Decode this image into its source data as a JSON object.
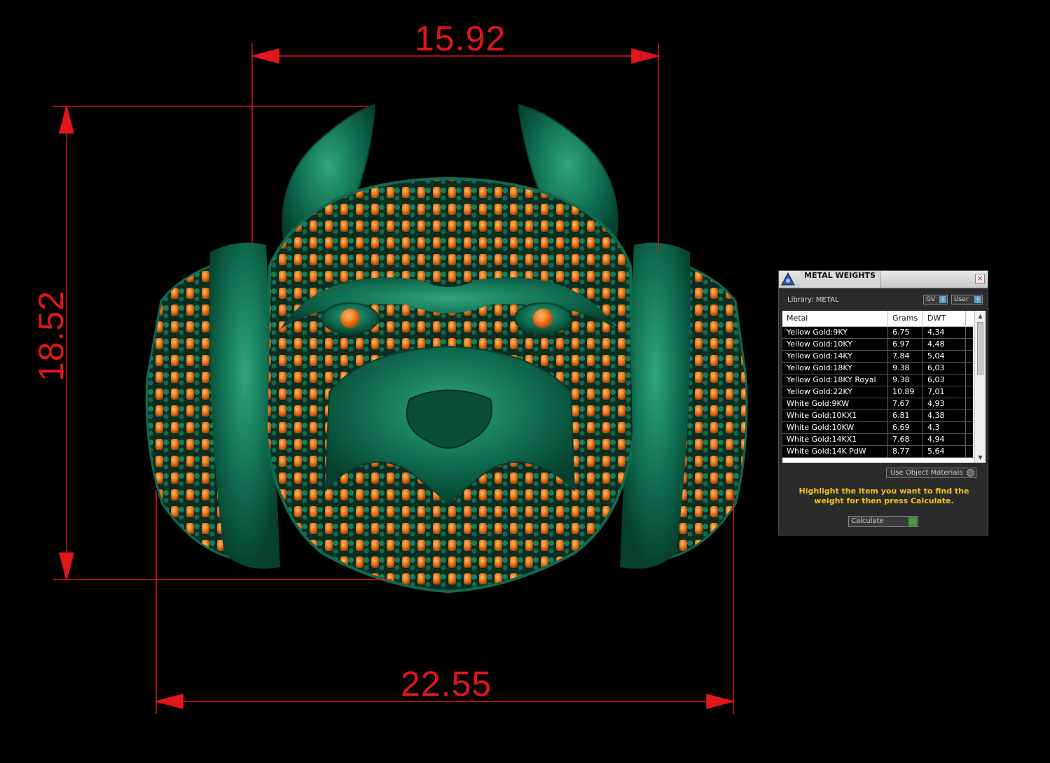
{
  "dimensions": {
    "top_width": "15.92",
    "left_height": "18.52",
    "bottom_width": "22.55"
  },
  "colors": {
    "dimension_lines": "#e0161c",
    "ring_metal": "#0f6b4f",
    "stones": "#f07a1a",
    "background": "#000000"
  },
  "panel": {
    "title": "METAL WEIGHTS",
    "close_glyph": "×",
    "library_label": "Library: METAL",
    "gv_label": "GV",
    "user_label": "User",
    "columns": [
      "Metal",
      "Grams",
      "DWT"
    ],
    "rows": [
      {
        "metal": "Yellow Gold:9KY",
        "grams": "6.75",
        "dwt": "4,34"
      },
      {
        "metal": "Yellow Gold:10KY",
        "grams": "6.97",
        "dwt": "4,48"
      },
      {
        "metal": "Yellow Gold:14KY",
        "grams": "7.84",
        "dwt": "5,04"
      },
      {
        "metal": "Yellow Gold:18KY",
        "grams": "9.38",
        "dwt": "6,03"
      },
      {
        "metal": "Yellow Gold:18KY Royal",
        "grams": "9.38",
        "dwt": "6,03"
      },
      {
        "metal": "Yellow Gold:22KY",
        "grams": "10.89",
        "dwt": "7,01"
      },
      {
        "metal": "White Gold:9KW",
        "grams": "7.67",
        "dwt": "4,93"
      },
      {
        "metal": "White Gold:10KX1",
        "grams": "6.81",
        "dwt": "4,38"
      },
      {
        "metal": "White Gold:10KW",
        "grams": "6.69",
        "dwt": "4,3"
      },
      {
        "metal": "White Gold:14KX1",
        "grams": "7.68",
        "dwt": "4,94"
      },
      {
        "metal": "White Gold:14K PdW",
        "grams": "8.77",
        "dwt": "5,64"
      }
    ],
    "use_object_materials": "Use Object Materials",
    "instructions": "Highlight the item you want to find the weight for then press Calculate.",
    "calculate_label": "Calculate"
  }
}
